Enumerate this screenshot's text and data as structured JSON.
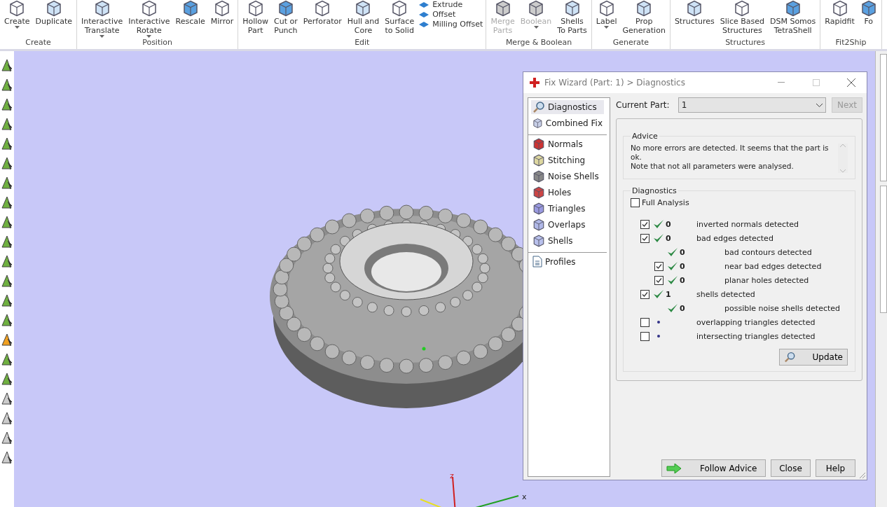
{
  "ribbon": {
    "groups": [
      {
        "label": "Create",
        "buttons": [
          {
            "label": "Create",
            "dropdown": true,
            "disabled": false
          },
          {
            "label": "Duplicate",
            "dropdown": false,
            "disabled": false
          }
        ]
      },
      {
        "label": "Position",
        "buttons": [
          {
            "label": "Interactive\nTranslate",
            "dropdown": true,
            "disabled": false
          },
          {
            "label": "Interactive\nRotate",
            "dropdown": true,
            "disabled": false
          },
          {
            "label": "Rescale",
            "dropdown": false,
            "disabled": false
          },
          {
            "label": "Mirror",
            "dropdown": false,
            "disabled": false
          }
        ]
      },
      {
        "label": "Edit",
        "buttons": [
          {
            "label": "Hollow\nPart",
            "dropdown": false,
            "disabled": false
          },
          {
            "label": "Cut or\nPunch",
            "dropdown": false,
            "disabled": false
          },
          {
            "label": "Perforator",
            "dropdown": false,
            "disabled": false
          },
          {
            "label": "Hull and\nCore",
            "dropdown": false,
            "disabled": false
          },
          {
            "label": "Surface\nto Solid",
            "dropdown": false,
            "disabled": false
          }
        ],
        "small_buttons": [
          "Extrude",
          "Offset",
          "Milling Offset"
        ]
      },
      {
        "label": "Merge & Boolean",
        "buttons": [
          {
            "label": "Merge\nParts",
            "dropdown": false,
            "disabled": true
          },
          {
            "label": "Boolean",
            "dropdown": true,
            "disabled": true
          },
          {
            "label": "Shells\nTo Parts",
            "dropdown": false,
            "disabled": false
          }
        ]
      },
      {
        "label": "Generate",
        "buttons": [
          {
            "label": "Label",
            "dropdown": true,
            "disabled": false
          },
          {
            "label": "Prop\nGeneration",
            "dropdown": false,
            "disabled": false
          }
        ]
      },
      {
        "label": "Structures",
        "buttons": [
          {
            "label": "Structures",
            "dropdown": false,
            "disabled": false
          },
          {
            "label": "Slice Based\nStructures",
            "dropdown": false,
            "disabled": false
          },
          {
            "label": "DSM Somos\nTetraShell",
            "dropdown": false,
            "disabled": false
          }
        ]
      },
      {
        "label": "Fit2Ship",
        "buttons": [
          {
            "label": "Rapidfit",
            "dropdown": false,
            "disabled": false
          },
          {
            "label": "Fo",
            "dropdown": false,
            "disabled": false
          }
        ]
      }
    ]
  },
  "viewport": {
    "axis_labels": [
      "z",
      "x"
    ]
  },
  "dialog": {
    "title": "Fix Wizard (Part: 1) > Diagnostics",
    "nav": [
      [
        {
          "label": "Diagnostics",
          "selected": true
        },
        {
          "label": "Combined Fix",
          "selected": false
        }
      ],
      [
        {
          "label": "Normals",
          "selected": false
        },
        {
          "label": "Stitching",
          "selected": false
        },
        {
          "label": "Noise Shells",
          "selected": false
        },
        {
          "label": "Holes",
          "selected": false
        },
        {
          "label": "Triangles",
          "selected": false
        },
        {
          "label": "Overlaps",
          "selected": false
        },
        {
          "label": "Shells",
          "selected": false
        }
      ],
      [
        {
          "label": "Profiles",
          "selected": false
        }
      ]
    ],
    "current_part": {
      "label": "Current Part:",
      "value": "1"
    },
    "next_button": {
      "label": "Next",
      "disabled": true
    },
    "advice": {
      "title": "Advice",
      "text": "No more errors are detected. It seems that the part is ok.\nNote that not all parameters were analysed."
    },
    "diagnostics": {
      "title": "Diagnostics",
      "full_analysis": {
        "label": "Full Analysis",
        "checked": false
      },
      "rows": [
        {
          "kind": "checkable",
          "checked": true,
          "passed": true,
          "count": "0",
          "label": "inverted normals detected"
        },
        {
          "kind": "checkable",
          "checked": true,
          "passed": true,
          "count": "0",
          "label": "bad edges detected",
          "children": [
            {
              "kind": "plain",
              "passed": true,
              "count": "0",
              "label": "bad contours detected"
            },
            {
              "kind": "checkable",
              "checked": true,
              "passed": true,
              "count": "0",
              "label": "near bad edges detected"
            },
            {
              "kind": "checkable",
              "checked": true,
              "passed": true,
              "count": "0",
              "label": "planar holes detected"
            }
          ]
        },
        {
          "kind": "checkable",
          "checked": true,
          "passed": true,
          "count": "1",
          "label": "shells detected",
          "children": [
            {
              "kind": "plain",
              "passed": true,
              "count": "0",
              "label": "possible noise shells detected"
            }
          ]
        },
        {
          "kind": "checkable",
          "checked": false,
          "passed": false,
          "label": "overlapping triangles detected"
        },
        {
          "kind": "checkable",
          "checked": false,
          "passed": false,
          "label": "intersecting triangles detected"
        }
      ],
      "update_button": "Update"
    },
    "buttons": [
      "Follow Advice",
      "Close",
      "Help"
    ]
  }
}
